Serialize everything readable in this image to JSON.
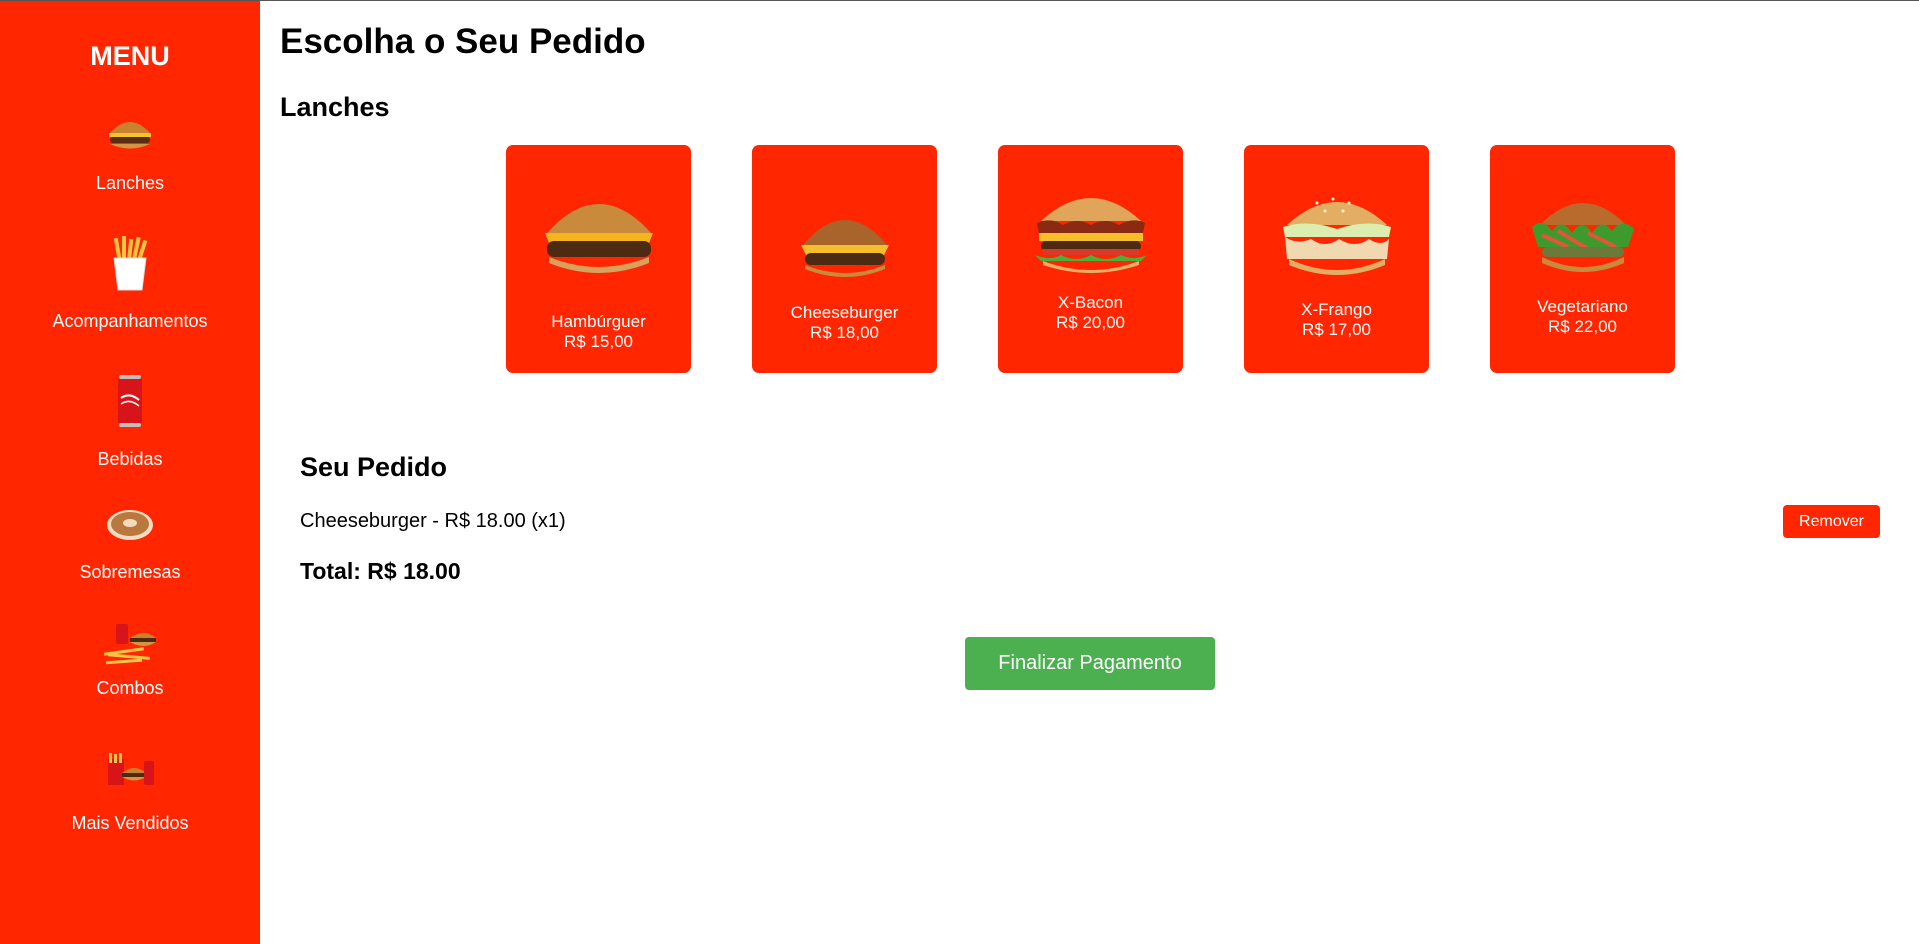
{
  "sidebar": {
    "title": "MENU",
    "items": [
      {
        "label": "Lanches",
        "icon": "burger-icon"
      },
      {
        "label": "Acompanhamentos",
        "icon": "fries-icon"
      },
      {
        "label": "Bebidas",
        "icon": "soda-can-icon"
      },
      {
        "label": "Sobremesas",
        "icon": "donut-icon"
      },
      {
        "label": "Combos",
        "icon": "combo-meal-icon"
      },
      {
        "label": "Mais Vendidos",
        "icon": "best-sellers-icon"
      }
    ]
  },
  "main": {
    "title": "Escolha o Seu Pedido",
    "section_title": "Lanches",
    "products": [
      {
        "name": "Hambúrguer",
        "price": "R$ 15,00",
        "icon": "hamburger-image"
      },
      {
        "name": "Cheeseburger",
        "price": "R$ 18,00",
        "icon": "cheeseburger-image"
      },
      {
        "name": "X-Bacon",
        "price": "R$ 20,00",
        "icon": "x-bacon-image"
      },
      {
        "name": "X-Frango",
        "price": "R$ 17,00",
        "icon": "x-frango-image"
      },
      {
        "name": "Vegetariano",
        "price": "R$ 22,00",
        "icon": "vegetarian-burger-image"
      }
    ]
  },
  "order": {
    "title": "Seu Pedido",
    "items": [
      {
        "text": "Cheeseburger - R$ 18.00 (x1)",
        "remove_label": "Remover"
      }
    ],
    "total": "Total: R$ 18.00",
    "checkout_label": "Finalizar Pagamento"
  },
  "colors": {
    "brand_red": "#ff2600",
    "checkout_green": "#4caf50",
    "text": "#000000"
  }
}
